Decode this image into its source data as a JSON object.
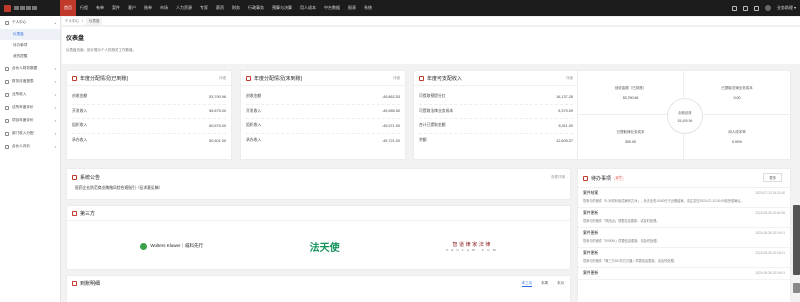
{
  "nav": {
    "items": [
      "首页",
      "行程",
      "有单",
      "案件",
      "客户",
      "账单",
      "市场",
      "人力资源",
      "专家",
      "薪资",
      "财务",
      "行政事务",
      "预算与决算",
      "用人成本",
      "中台数据",
      "报表",
      "系统"
    ],
    "active_index": 0
  },
  "topbar": {
    "user_menu": "业务助理 ▾"
  },
  "sidebar": {
    "groups": [
      {
        "label": "个人中心",
        "expanded": true,
        "children": [
          "仪表盘",
          "待办事项",
          "我的提醒"
        ]
      },
      {
        "label": "合伙人财务数据",
        "expanded": false
      },
      {
        "label": "财务月度报表",
        "expanded": false
      },
      {
        "label": "业所收入",
        "expanded": false
      },
      {
        "label": "法所年度评价",
        "expanded": false
      },
      {
        "label": "项目年度评价",
        "expanded": false
      },
      {
        "label": "部门收入分配",
        "expanded": false
      },
      {
        "label": "合伙人评价",
        "expanded": false
      }
    ],
    "active_child": "仪表盘"
  },
  "breadcrumb": {
    "items": [
      "个人中心",
      "仪表盘"
    ]
  },
  "header": {
    "title": "仪表盘",
    "desc": "仪表盘页面，统计展示个人的相关工作数值。"
  },
  "cards": [
    {
      "title": "年度分配情况(已到账)",
      "link": "详细",
      "rows": [
        {
          "label": "创收金额",
          "value": "53,790.96"
        },
        {
          "label": "开发收入",
          "value": "55,675.00"
        },
        {
          "label": "组织收入",
          "value": "60,675.00"
        },
        {
          "label": "承办收入",
          "value": "50,601.00"
        }
      ]
    },
    {
      "title": "年度分配情况(未到账)",
      "link": "详细",
      "rows": [
        {
          "label": "创收金额",
          "value": "-49,862.53"
        },
        {
          "label": "开发收入",
          "value": "-49,985.50"
        },
        {
          "label": "组织收入",
          "value": "-49,971.00"
        },
        {
          "label": "承办收入",
          "value": "-49,721.00"
        }
      ]
    },
    {
      "title": "年度可支配收入",
      "link": "详细",
      "rows": [
        {
          "label": "可提取预提分红",
          "value": "16,137.28"
        },
        {
          "label": "可提取法律业务成本",
          "value": "5,379.09"
        },
        {
          "label": "合计已提取金额",
          "value": "8,911.00"
        },
        {
          "label": "余额",
          "value": "12,605.37"
        }
      ]
    }
  ],
  "quad": {
    "tl": {
      "label": "创收金额（已到账）",
      "value": "53,790.96"
    },
    "tr": {
      "label": "已提取法律业务成本",
      "value": "0.00"
    },
    "bl": {
      "label": "已提取律业务成本",
      "value": "300.00"
    },
    "br": {
      "label": "用人成本率",
      "value": "0.00%"
    },
    "center": {
      "label": "创收绩效",
      "value": "53,490.96"
    }
  },
  "notice": {
    "title": "系统公告",
    "link": "查看详情",
    "body": "医药企业防范商业贿赂风险合规指引（征求意见稿）"
  },
  "third": {
    "title": "第三方",
    "logos": {
      "wk": "Wolters Kluwer｜威科先行",
      "fa": "法天使",
      "zl": "智 道 律 家 法 律",
      "zl_sub": "P K U L A W . C O M"
    }
  },
  "todo": {
    "title": "待办事项",
    "count": "5个",
    "more": "更多",
    "items": [
      {
        "name": "案件结案",
        "date": "2023-07-13 15:32:40",
        "content": "您参与的案件「Ⅱ-39关利测试案例之0Ⅱ」，负责业的-0000已于近期结案。请注意在2023-07-12 00:00前完成确认。"
      },
      {
        "name": "案件更新",
        "date": "2024-05-26 20:51:06",
        "content": "您参与的案件「风险点」项更信息更新。请及时处理。"
      },
      {
        "name": "案件更新",
        "date": "2024-05-26 20:19:01",
        "content": "您参与的案件「00000Ⅰ」项更信息更新。请及时处理。"
      },
      {
        "name": "案件更新",
        "date": "2024-05-26 20:16:01",
        "content": "您参与的案件「第三方DD东方万通」项更信息更新。请及时处理。"
      },
      {
        "name": "案件更新",
        "date": "2024-05-26 20:18:01",
        "content": ""
      }
    ]
  },
  "payments": {
    "title": "到账明细",
    "tabs": [
      "本三月",
      "本周",
      "本月"
    ]
  },
  "colors": {
    "brand": "#c0392b",
    "topbar": "#1c1c1c",
    "accent": "#2b6de0"
  }
}
